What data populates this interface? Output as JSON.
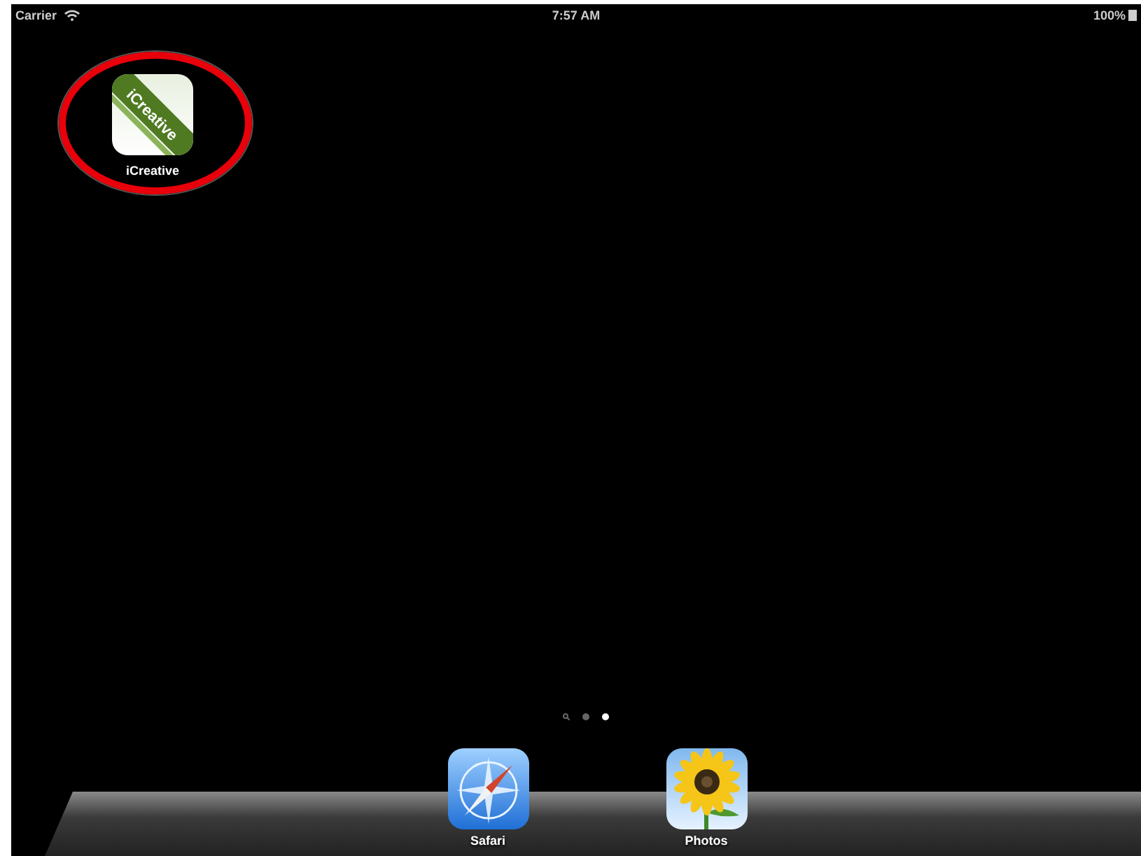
{
  "status_bar": {
    "carrier": "Carrier",
    "time": "7:57 AM",
    "battery": "100%"
  },
  "apps": [
    {
      "kind": "creative",
      "label": "iCreative",
      "logo_text": "iCreative",
      "circled": true
    }
  ],
  "page_dots": [
    {
      "kind": "search",
      "selected": false
    },
    {
      "kind": "dot",
      "selected": false
    },
    {
      "kind": "dot",
      "selected": true
    }
  ],
  "dock": [
    {
      "kind": "compass",
      "label": "Safari"
    },
    {
      "kind": "sunflower",
      "label": "Photos"
    }
  ]
}
